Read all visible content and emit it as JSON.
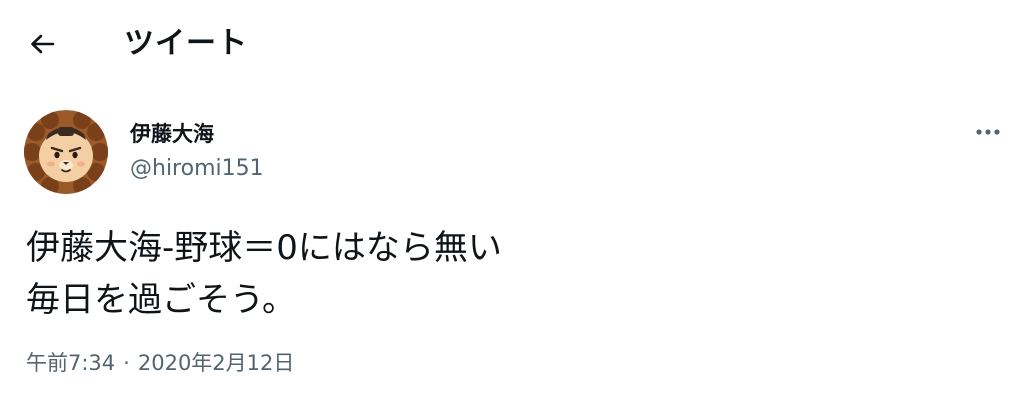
{
  "header": {
    "back_icon": "arrow-left-icon",
    "title": "ツイート"
  },
  "author": {
    "avatar_icon": "lion-avatar",
    "display_name": "伊藤大海",
    "handle": "@hiromi151"
  },
  "more_icon": "more-horizontal-icon",
  "tweet": {
    "text": "伊藤大海-野球＝0にはなら無い\n毎日を過ごそう。",
    "time": "午前7:34",
    "separator": "·",
    "date": "2020年2月12日"
  },
  "colors": {
    "text_primary": "#0f1419",
    "text_secondary": "#536471",
    "background": "#ffffff"
  }
}
